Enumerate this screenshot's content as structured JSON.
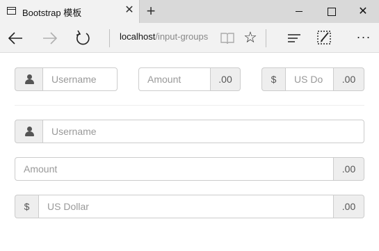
{
  "browser": {
    "tab_title": "Bootstrap 模板",
    "tab_close": "✕",
    "new_tab": "+",
    "window_close": "✕",
    "url_host": "localhost",
    "url_path": "/input-groups",
    "more": "···",
    "icons": {
      "back": "back-arrow-icon",
      "forward": "forward-arrow-icon",
      "refresh": "refresh-icon",
      "reading": "reading-view-icon",
      "favorite": "star-icon",
      "hub": "hub-icon",
      "note": "web-note-icon"
    }
  },
  "page": {
    "row1": {
      "username_placeholder": "Username",
      "amount_placeholder": "Amount",
      "amount_suffix": ".00",
      "dollar_prefix": "$",
      "usd_placeholder": "US Do",
      "usd_suffix": ".00"
    },
    "row2": {
      "username_placeholder": "Username"
    },
    "row3": {
      "amount_placeholder": "Amount",
      "amount_suffix": ".00"
    },
    "row4": {
      "dollar_prefix": "$",
      "usd_placeholder": "US Dollar",
      "usd_suffix": ".00"
    }
  }
}
